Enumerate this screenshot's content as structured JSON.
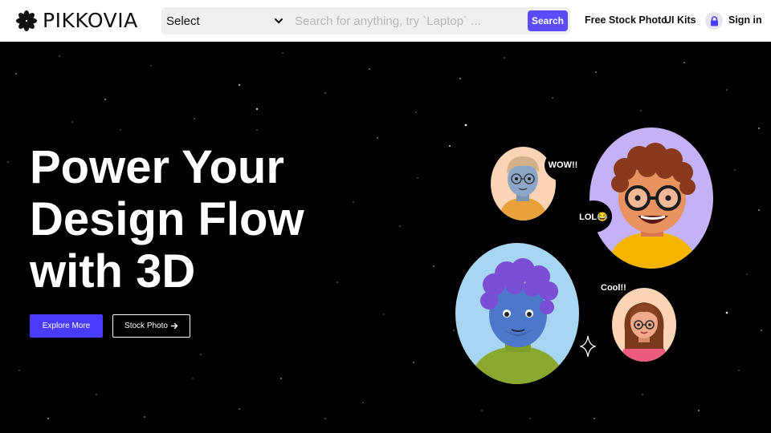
{
  "header": {
    "brand": "PIKKOVIA",
    "select": {
      "value": "Select"
    },
    "search": {
      "placeholder": "Search for anything, try `Laptop` ...",
      "button_label": "Search"
    },
    "nav": {
      "free_stock_photo": "Free Stock Photo",
      "ui_kits": "UI Kits",
      "sign_in": "Sign in"
    },
    "icons": {
      "logo": "asterisk-flower-icon",
      "chevron": "chevron-down-icon",
      "lock": "lock-icon"
    }
  },
  "hero": {
    "headline": [
      "Power Your",
      "Design Flow",
      "with 3D"
    ],
    "buttons": {
      "explore": "Explore More",
      "stock_photo": "Stock Photo"
    },
    "icons": {
      "stock_photo_arrow": "arrow-right-icon",
      "sparkle": "sparkle-icon"
    },
    "bubbles": {
      "wow": "WOW!!",
      "lol": "LOL😂",
      "cool": "Cool!!"
    }
  },
  "colors": {
    "accent": "#5b4dff",
    "hero_bg": "#000000",
    "avatar_peach": "#fbd3b5",
    "avatar_lilac": "#c5b1f5",
    "avatar_sky": "#a8d5f2"
  }
}
